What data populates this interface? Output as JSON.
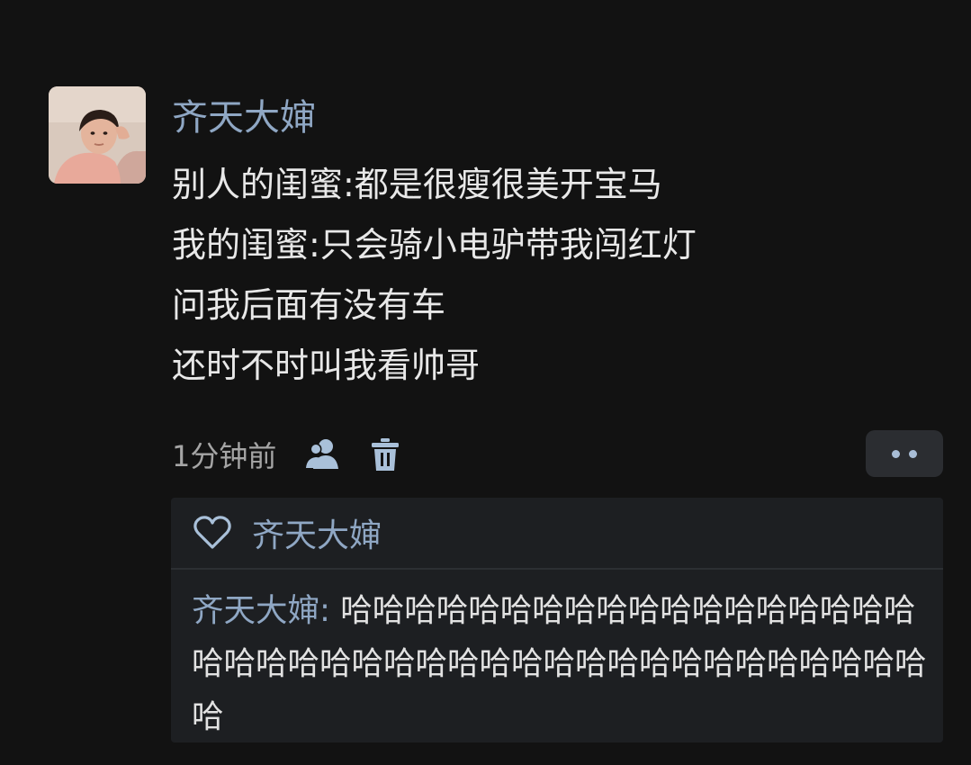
{
  "post": {
    "author": "齐天大婶",
    "lines": [
      "别人的闺蜜:都是很瘦很美开宝马",
      "我的闺蜜:只会骑小电驴带我闯红灯",
      "问我后面有没有车",
      "还时不时叫我看帅哥"
    ],
    "timestamp": "1分钟前",
    "icons": {
      "visibility": "people-icon",
      "delete": "trash-icon",
      "more": "more-dots-icon"
    }
  },
  "reply_panel": {
    "like_icon": "heart-icon",
    "liker": "齐天大婶",
    "comments": [
      {
        "author": "齐天大婶",
        "separator": ": ",
        "text": "哈哈哈哈哈哈哈哈哈哈哈哈哈哈哈哈哈哈哈哈哈哈哈哈哈哈哈哈哈哈哈哈哈哈哈哈哈哈哈哈哈哈"
      }
    ]
  },
  "colors": {
    "background": "#121212",
    "name_accent": "#8fa7c4",
    "panel": "#1d1f22"
  }
}
